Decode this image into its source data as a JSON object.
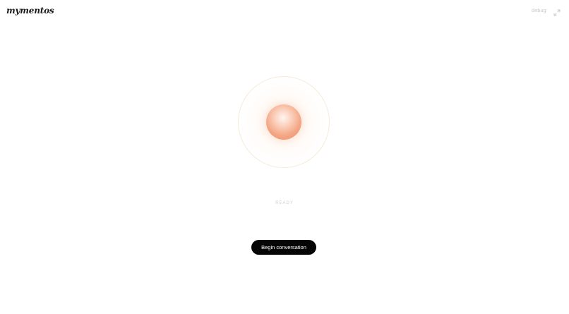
{
  "header": {
    "logo_text": "mymentos",
    "debug_label": "debug",
    "expand_icon": "expand-icon"
  },
  "orb": {
    "icon": "voice-orb",
    "core_color": "#f4a785",
    "ring_color": "#f7ead8"
  },
  "status": {
    "label": "READY"
  },
  "actions": {
    "begin_label": "Begin conversation"
  }
}
